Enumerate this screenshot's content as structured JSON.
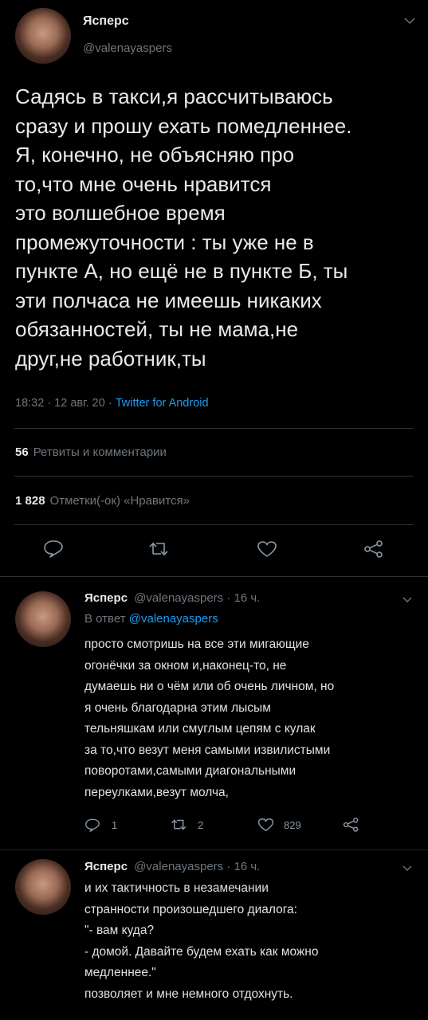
{
  "main_tweet": {
    "display_name": "Ясперс",
    "handle": "@valenayaspers",
    "text": "Садясь в такси,я рассчитываюсь\nсразу и прошу ехать помедленнее.\nЯ, конечно, не объясняю про\nто,что мне очень нравится\nэто волшебное время\nпромежуточности : ты уже не в\nпункте А, но ещё не в пункте Б, ты\nэти полчаса не имеешь никаких\nобязанностей, ты не мама,не\nдруг,не работник,ты",
    "meta": "18:32 · 12 авг. 20 · ",
    "source": "Twitter for Android",
    "retweets_count": "56",
    "retweets_label": "Ретвиты и комментарии",
    "likes_count": "1 828",
    "likes_label": "Отметки(-ок) «Нравится»"
  },
  "replies": [
    {
      "display_name": "Ясперс",
      "handle_time": "@valenayaspers · 16 ч.",
      "reply_to_prefix": "В ответ ",
      "reply_to_handle": "@valenayaspers",
      "text": "просто смотришь на все эти мигающие\nогонёчки за окном и,наконец-то, не\nдумаешь ни о чём или об очень личном, но\nя очень благодарна этим лысым\nтельняшкам или смуглым цепям с кулак\nза то,что везут меня самыми извилистыми\nповоротами,самыми диагональными\nпереулками,везут молча,",
      "reply_count": "1",
      "retweet_count": "2",
      "like_count": "829"
    },
    {
      "display_name": "Ясперс",
      "handle_time": "@valenayaspers · 16 ч.",
      "text": "и их тактичность в незамечании\nстранности произошедшего диалога:\n\"- вам куда?\n- домой. Давайте будем ехать как можно\nмедленнее.\"\nпозволяет и мне немного отдохнуть."
    }
  ]
}
